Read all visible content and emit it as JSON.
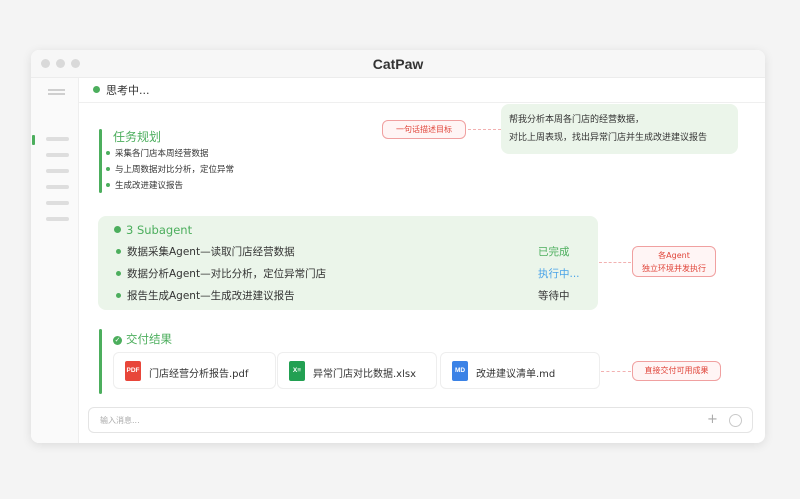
{
  "window": {
    "title": "CatPaw"
  },
  "status": {
    "thinking": "思考中..."
  },
  "user_message": {
    "lines": [
      "帮我分析本周各门店的经营数据，",
      "对比上周表现，找出异常门店并生成改进建议报告"
    ]
  },
  "annotations": {
    "goal": "一句话描述目标",
    "agents": [
      "各Agent",
      "独立环境并发执行"
    ],
    "deliver": "直接交付可用成果"
  },
  "task_plan": {
    "title": "任务规划",
    "items": [
      "采集各门店本周经营数据",
      "与上周数据对比分析，定位异常",
      "生成改进建议报告"
    ]
  },
  "subagents": {
    "title": "3 Subagent",
    "rows": [
      {
        "name": "数据采集Agent—读取门店经营数据",
        "status": "已完成",
        "status_color": "#4cae5d"
      },
      {
        "name": "数据分析Agent—对比分析，定位异常门店",
        "status": "执行中...",
        "status_color": "#4aa3e8"
      },
      {
        "name": "报告生成Agent—生成改进建议报告",
        "status": "等待中",
        "status_color": "#333333"
      }
    ]
  },
  "deliverables": {
    "title": "交付结果",
    "files": [
      {
        "type": "PDF",
        "name": "门店经营分析报告.pdf",
        "color": "#e8463a",
        "icon": "pdf-icon"
      },
      {
        "type": "X≡",
        "name": "异常门店对比数据.xlsx",
        "color": "#22a052",
        "icon": "excel-icon"
      },
      {
        "type": "MD",
        "name": "改进建议清单.md",
        "color": "#3b82e6",
        "icon": "markdown-icon"
      }
    ]
  },
  "input": {
    "placeholder": "输入消息..."
  },
  "colors": {
    "accent": "#4cae5d",
    "annotation": "#e0453a",
    "bubble": "#ebf5ea"
  }
}
